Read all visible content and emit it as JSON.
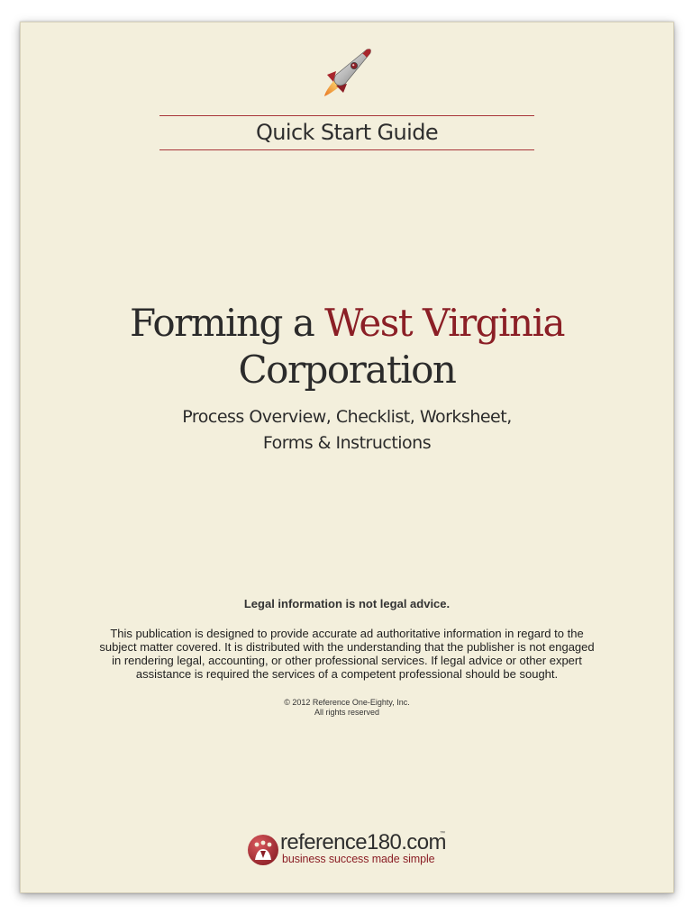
{
  "guide": {
    "header": "Quick Start Guide"
  },
  "title": {
    "prefix": "Forming a",
    "state": "West Virginia",
    "entity": "Corporation"
  },
  "subtitle": {
    "line1": "Process Overview, Checklist, Worksheet,",
    "line2": "Forms & Instructions"
  },
  "disclaimer": {
    "heading": "Legal information is not legal advice.",
    "lines": [
      "This publication is designed to provide accurate ad authoritative information in regard to the",
      "subject matter covered. It is distributed with the understanding that the publisher is not engaged",
      "in rendering legal, accounting, or other professional services. If legal advice or other expert",
      "assistance is required the services of a competent professional should be sought."
    ]
  },
  "copyright": {
    "line1": "© 2012 Reference One-Eighty, Inc.",
    "line2": "All rights reserved"
  },
  "brand": {
    "name": "reference180.com",
    "tm": "™",
    "tagline": "business success made simple"
  },
  "icons": {
    "rocket": "rocket-icon",
    "brand_mark": "reference180-logo-icon"
  },
  "colors": {
    "page": "#f3efdc",
    "accent": "#8b1f26",
    "text": "#2b2b2b"
  }
}
